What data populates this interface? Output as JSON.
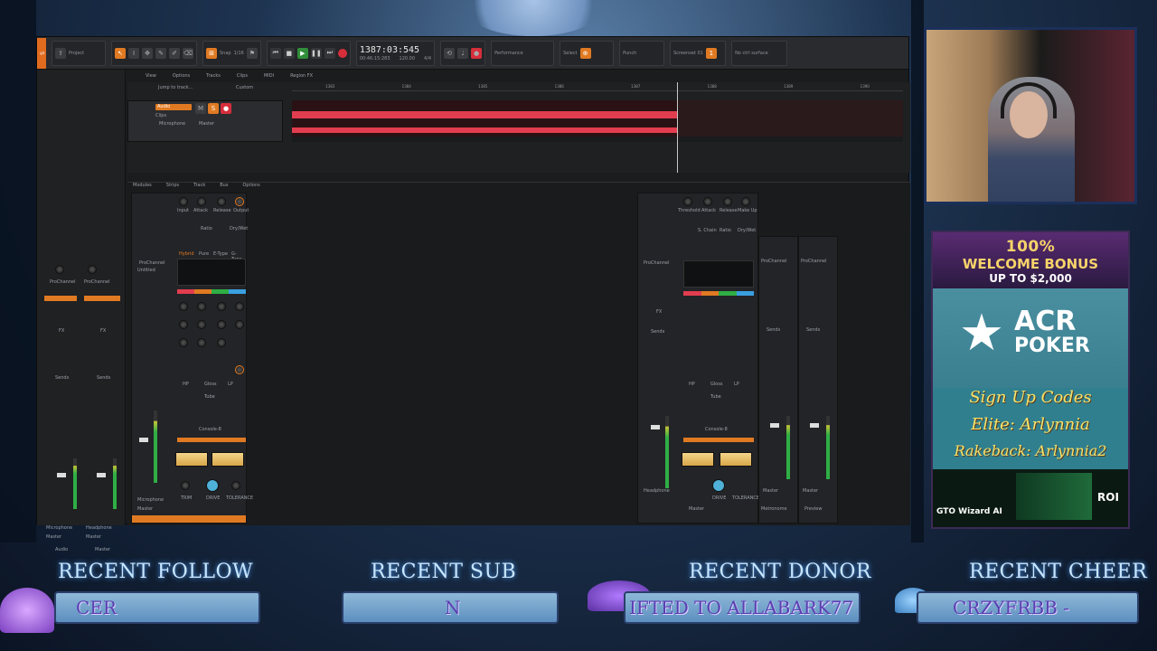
{
  "daw": {
    "transport": {
      "timecode": "1387:03:545",
      "timecode_sub": "00:46:15:283",
      "tempo": "120.00",
      "meter": "4/4"
    },
    "toolbar": {
      "tools": [
        "Smart",
        "Select",
        "Move",
        "Edit",
        "Draw",
        "Erase"
      ],
      "snap_label": "Snap",
      "snap_value": "1/16",
      "markers_label": "Markers",
      "performance_label": "Performance",
      "select_label": "Select",
      "punch_label": "Punch",
      "screenset_label": "Screenset 01",
      "ctrl_surface_label": "No ctrl surface"
    },
    "menubar": [
      "View",
      "Options",
      "Tracks",
      "Clips",
      "MIDI",
      "Region FX"
    ],
    "ruler_marks": [
      "1383",
      "1384",
      "1385",
      "1386",
      "1387",
      "1388",
      "1389",
      "1390"
    ],
    "track": {
      "name": "Audio",
      "clips_label": "Clips",
      "input_label": "Microphone",
      "output_label": "Master"
    },
    "jump_label": "Jump to track...",
    "custom_label": "Custom",
    "console_menu": [
      "Modules",
      "Strips",
      "Track",
      "Bus",
      "Options"
    ],
    "strip_labels": {
      "prochannel": "ProChannel",
      "untitled": "Untitled",
      "fx": "FX",
      "sends": "Sends",
      "tube": "Tube",
      "console": "Console-8",
      "hp": "HP",
      "gloss": "Gloss",
      "lp": "LP",
      "input": "Input",
      "attack": "Attack",
      "release": "Release",
      "output": "Output",
      "threshold": "Threshold",
      "makeup": "Make Up",
      "ratio": "Ratio",
      "drywet": "Dry/Wet",
      "schain": "S. Chain",
      "hybrid": "Hybrid",
      "pure": "Pure",
      "etype": "E-Type",
      "gtype": "G-Type",
      "trim": "TRIM",
      "drive": "DRIVE",
      "tolerance": "TOLERANCE",
      "microphone": "Microphone",
      "headphone": "Headphone",
      "master": "Master",
      "audio": "Audio",
      "metronome": "Metronome",
      "preview": "Preview"
    },
    "colors": {
      "accent": "#e07a22",
      "waveform": "#e23d4f",
      "meter_green": "#2fae45",
      "record": "#d62e3b",
      "play": "#2f8f3a"
    }
  },
  "ad": {
    "bonus_line1": "100%",
    "bonus_line2": "WELCOME BONUS",
    "bonus_line3": "UP TO $2,000",
    "brand_line1": "ACR",
    "brand_line2": "POKER",
    "signup": "Sign Up Codes",
    "elite": "Elite: Arlynnia",
    "rakeback": "Rakeback: Arlynnia2",
    "gto": "GTO Wizard AI",
    "roi": "ROI"
  },
  "banners": [
    {
      "title": "RECENT FOLLOW",
      "value": "CER"
    },
    {
      "title": "RECENT SUB",
      "value": "N"
    },
    {
      "title": "RECENT DONOR",
      "value": "IFTED TO ALLABARK77"
    },
    {
      "title": "RECENT CHEER",
      "value": "CRZYFRBB -"
    }
  ]
}
